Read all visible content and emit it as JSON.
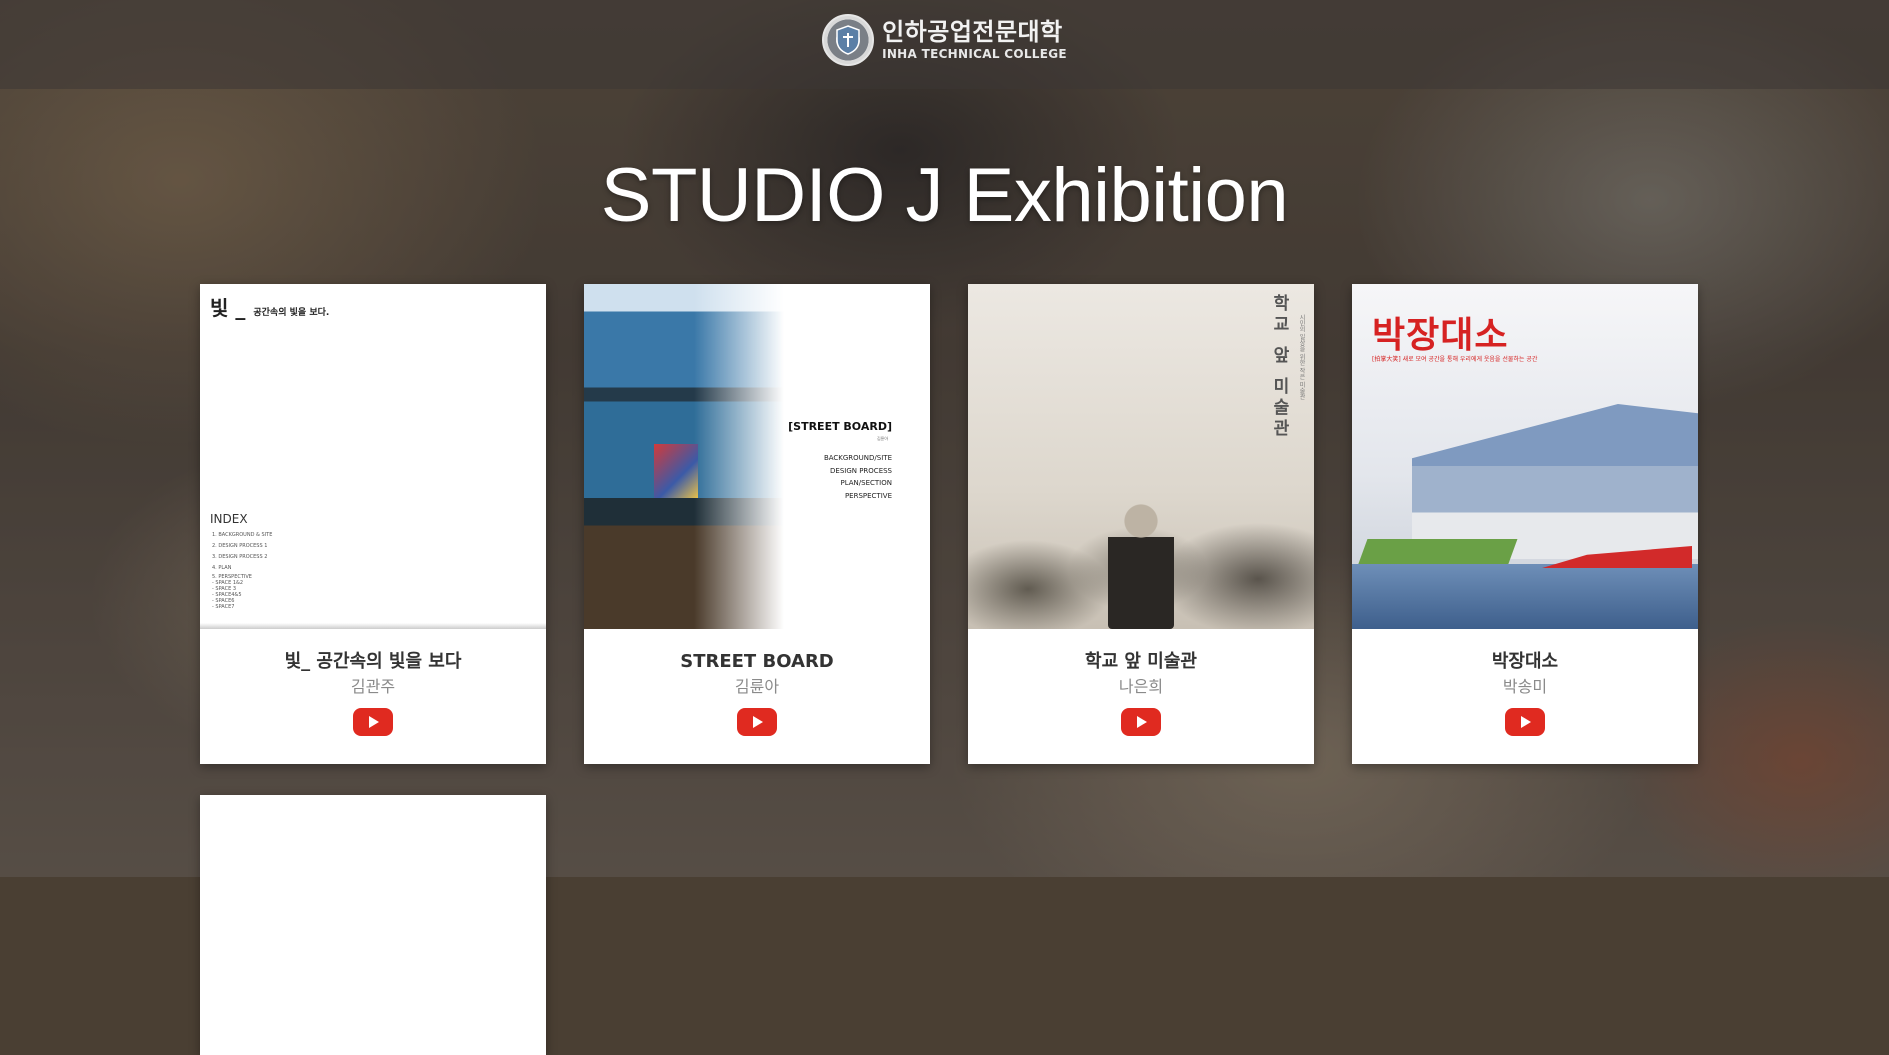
{
  "header": {
    "logo_ko": "인하공업전문대학",
    "logo_en": "INHA TECHNICAL COLLEGE",
    "emblem_icon": "college-emblem-icon"
  },
  "page": {
    "title": "STUDIO J Exhibition"
  },
  "cards": [
    {
      "title": "빛_ 공간속의 빛을 보다",
      "author": "김관주",
      "thumb": {
        "big": "빛 _",
        "small": "공간속의 빛을 보다.",
        "index": "INDEX",
        "items": [
          "1. BACKGROUND & SITE",
          "2. DESIGN PROCESS 1",
          "3. DESIGN PROCESS 2",
          "4. PLAN",
          "5. PERSPECTIVE",
          "- SPACE 1&2",
          "- SPACE 3",
          "- SPACE4&5",
          "- SPACE6",
          "- SPACE7"
        ]
      }
    },
    {
      "title": "STREET BOARD",
      "author": "김륜아",
      "thumb": {
        "title": "[STREET BOARD]",
        "sub": "김륜아",
        "items": [
          "BACKGROUND/SITE",
          "DESIGN PROCESS",
          "PLAN/SECTION",
          "PERSPECTIVE"
        ]
      }
    },
    {
      "title": "학교 앞 미술관",
      "author": "나은희",
      "thumb": {
        "title": "학교 앞 미술관",
        "sub": "시민의 일상을 위한 작은 미술관"
      }
    },
    {
      "title": "박장대소",
      "author": "박송미",
      "thumb": {
        "title": "박장대소",
        "sub": "[拍掌大笑] 새로 모여 공간을 통해 우리에게 웃음을 선물하는 공간"
      }
    }
  ],
  "play_icon": "youtube-play-icon"
}
